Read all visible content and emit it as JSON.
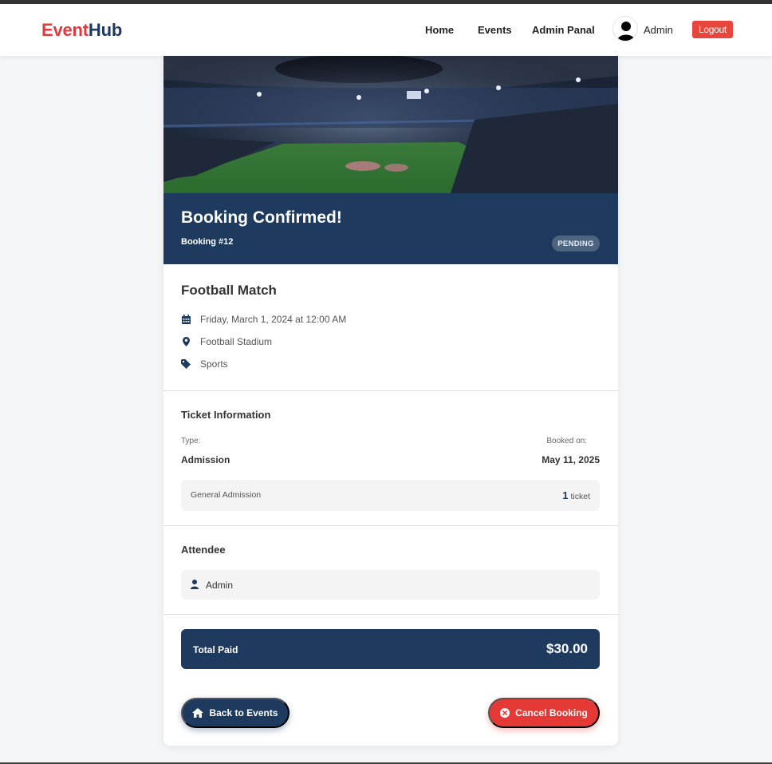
{
  "brand": {
    "part1": "Event",
    "part2": "Hub"
  },
  "nav": {
    "links": [
      "Home",
      "Events",
      "Admin Panal"
    ],
    "user_name": "Admin",
    "logout_label": "Logout"
  },
  "booking": {
    "confirmation_title": "Booking Confirmed!",
    "booking_number": "Booking #12",
    "status": "PENDING"
  },
  "event": {
    "title": "Football Match",
    "datetime": "Friday, March 1, 2024 at 12:00 AM",
    "location": "Football Stadium",
    "category": "Sports"
  },
  "ticket_info": {
    "section_title": "Ticket Information",
    "type_label": "Type:",
    "type_value": "Admission",
    "booked_label": "Booked on:",
    "booked_value": "May 11, 2025",
    "ticket_name": "General Admission",
    "quantity": "1",
    "quantity_unit": "ticket"
  },
  "attendee": {
    "section_title": "Attendee",
    "name": "Admin"
  },
  "payment": {
    "label": "Total Paid",
    "amount": "$30.00"
  },
  "actions": {
    "back_label": "Back to Events",
    "cancel_label": "Cancel Booking"
  },
  "icons": {
    "date": "calendar-icon",
    "location": "map-marker-icon",
    "category": "tag-icon",
    "attendee": "user-icon",
    "back": "home-icon",
    "cancel": "times-circle-icon"
  },
  "colors": {
    "navy": "#1e3a5f",
    "brand_red": "#e03a3e",
    "logout_red": "#e7463c",
    "cancel_red": "#e53935",
    "badge_bg": "#4e6581"
  }
}
